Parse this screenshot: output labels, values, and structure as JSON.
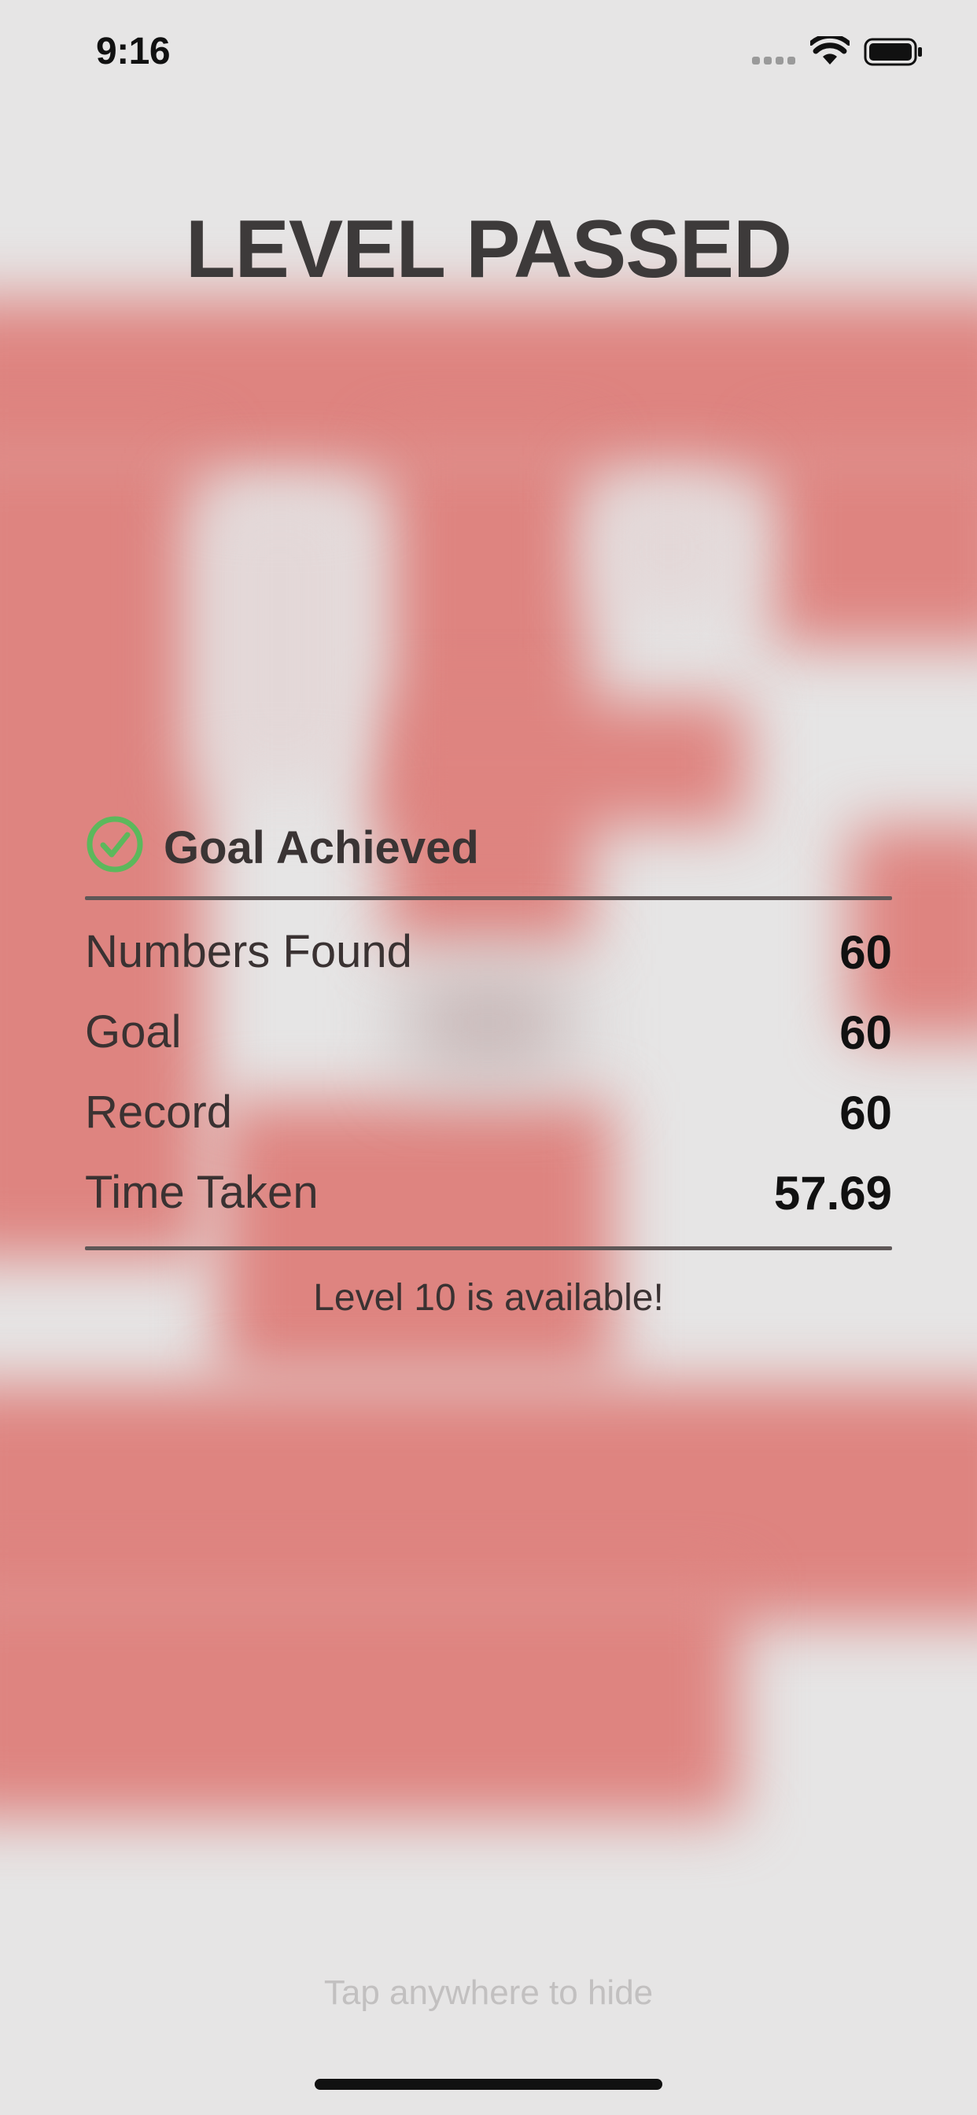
{
  "status_bar": {
    "time": "9:16"
  },
  "title": "LEVEL PASSED",
  "goal": {
    "label": "Goal Achieved",
    "status": "achieved"
  },
  "stats": [
    {
      "label": "Numbers Found",
      "value": "60"
    },
    {
      "label": "Goal",
      "value": "60"
    },
    {
      "label": "Record",
      "value": "60"
    },
    {
      "label": "Time Taken",
      "value": "57.69"
    }
  ],
  "unlock_message": "Level 10 is available!",
  "hint": "Tap anywhere to hide",
  "colors": {
    "background": "#e6e5e5",
    "blurred_tile": "#de8480",
    "check_green": "#5cb85c",
    "text_dark": "#3d3a3a"
  },
  "icons": {
    "goal": "check-circle-icon",
    "status": [
      "cellular-signal-icon",
      "wifi-icon",
      "battery-icon"
    ]
  }
}
